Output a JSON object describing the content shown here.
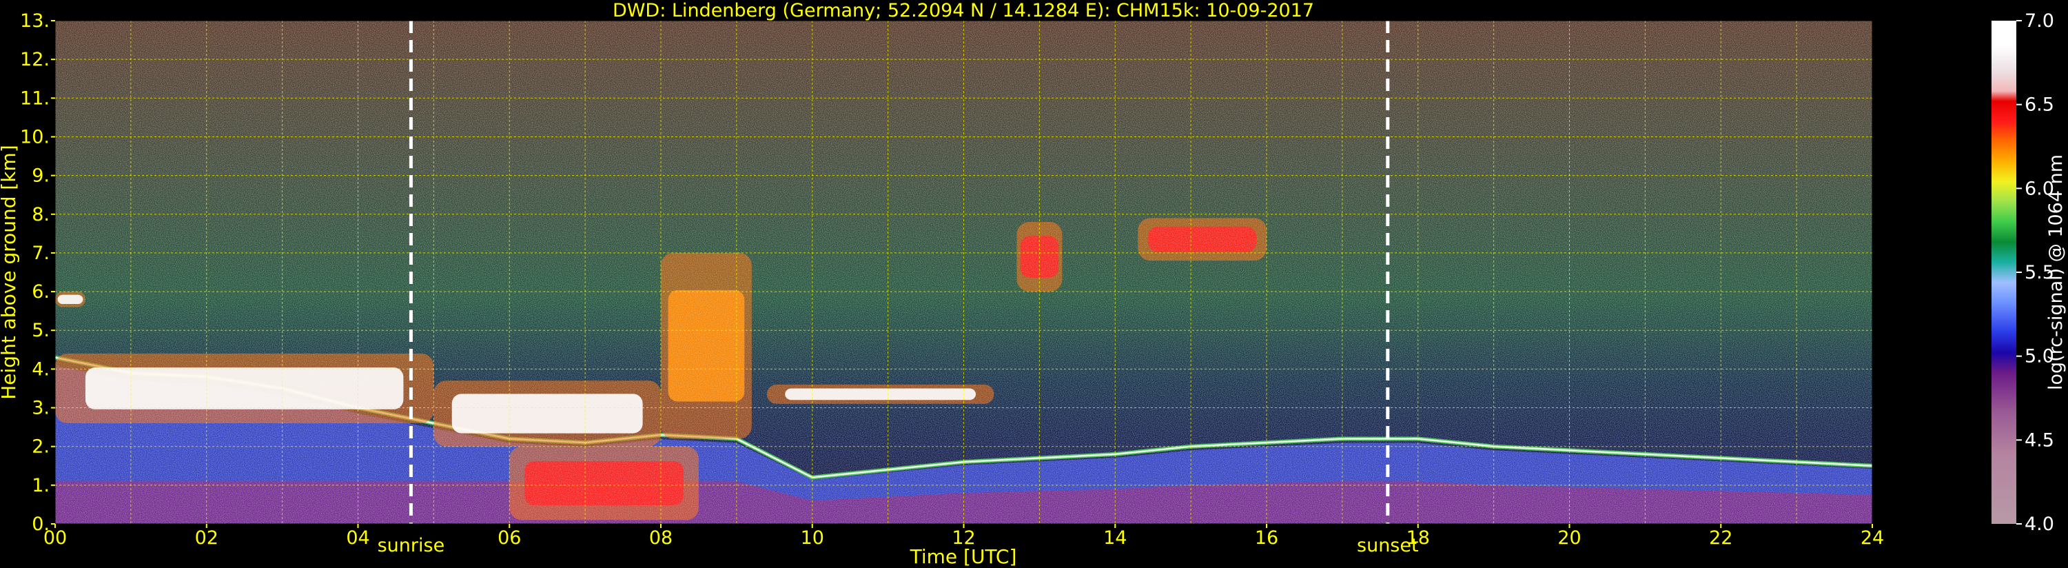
{
  "chart_data": {
    "type": "heatmap",
    "title": "DWD: Lindenberg (Germany; 52.2094 N / 14.1284 E):    CHM15k: 10-09-2017",
    "xlabel": "Time [UTC]",
    "ylabel": "Height above ground [km]",
    "xlim": [
      0,
      24
    ],
    "ylim": [
      0,
      13
    ],
    "x_ticks": [
      "00",
      "02",
      "04",
      "06",
      "08",
      "10",
      "12",
      "14",
      "16",
      "18",
      "20",
      "22",
      "24"
    ],
    "y_ticks": [
      "0.",
      "1.",
      "2.",
      "3.",
      "4.",
      "5.",
      "6.",
      "7.",
      "8.",
      "9.",
      "10.",
      "11.",
      "12.",
      "13."
    ],
    "grid": true,
    "colorbar": {
      "label": "log(rc-signal) @ 1064 nm",
      "range": [
        4.0,
        7.0
      ],
      "ticks": [
        "4.0",
        "4.5",
        "5.0",
        "5.5",
        "6.0",
        "6.5",
        "7.0"
      ]
    },
    "markers": [
      {
        "label": "sunrise",
        "x": 4.7
      },
      {
        "label": "sunset",
        "x": 17.6
      }
    ],
    "features": {
      "boundary_layer_top_km": [
        {
          "x": 0.0,
          "y": 4.3
        },
        {
          "x": 1.0,
          "y": 3.9
        },
        {
          "x": 2.0,
          "y": 3.8
        },
        {
          "x": 3.0,
          "y": 3.5
        },
        {
          "x": 4.0,
          "y": 3.0
        },
        {
          "x": 5.0,
          "y": 2.6
        },
        {
          "x": 6.0,
          "y": 2.2
        },
        {
          "x": 7.0,
          "y": 2.1
        },
        {
          "x": 8.0,
          "y": 2.3
        },
        {
          "x": 9.0,
          "y": 2.2
        },
        {
          "x": 10.0,
          "y": 1.2
        },
        {
          "x": 11.0,
          "y": 1.4
        },
        {
          "x": 12.0,
          "y": 1.6
        },
        {
          "x": 13.0,
          "y": 1.7
        },
        {
          "x": 14.0,
          "y": 1.8
        },
        {
          "x": 15.0,
          "y": 2.0
        },
        {
          "x": 16.0,
          "y": 2.1
        },
        {
          "x": 17.0,
          "y": 2.2
        },
        {
          "x": 18.0,
          "y": 2.2
        },
        {
          "x": 19.0,
          "y": 2.0
        },
        {
          "x": 20.0,
          "y": 1.9
        },
        {
          "x": 21.0,
          "y": 1.8
        },
        {
          "x": 22.0,
          "y": 1.7
        },
        {
          "x": 23.0,
          "y": 1.6
        },
        {
          "x": 24.0,
          "y": 1.5
        }
      ],
      "cloud_layers": [
        {
          "x0": 0.0,
          "x1": 5.0,
          "y0": 2.6,
          "y1": 4.4,
          "level": 6.8
        },
        {
          "x0": 5.0,
          "x1": 8.0,
          "y0": 2.0,
          "y1": 3.7,
          "level": 6.9
        },
        {
          "x0": 6.0,
          "x1": 8.5,
          "y0": 0.1,
          "y1": 2.0,
          "level": 6.4
        },
        {
          "x0": 8.0,
          "x1": 9.2,
          "y0": 2.2,
          "y1": 7.0,
          "level": 6.3
        },
        {
          "x0": 9.4,
          "x1": 12.4,
          "y0": 3.1,
          "y1": 3.6,
          "level": 7.0
        },
        {
          "x0": 12.7,
          "x1": 13.3,
          "y0": 6.0,
          "y1": 7.8,
          "level": 6.7
        },
        {
          "x0": 14.3,
          "x1": 16.0,
          "y0": 6.8,
          "y1": 7.9,
          "level": 6.7
        },
        {
          "x0": 0.0,
          "x1": 0.4,
          "y0": 5.6,
          "y1": 6.0,
          "level": 6.9
        }
      ]
    }
  }
}
